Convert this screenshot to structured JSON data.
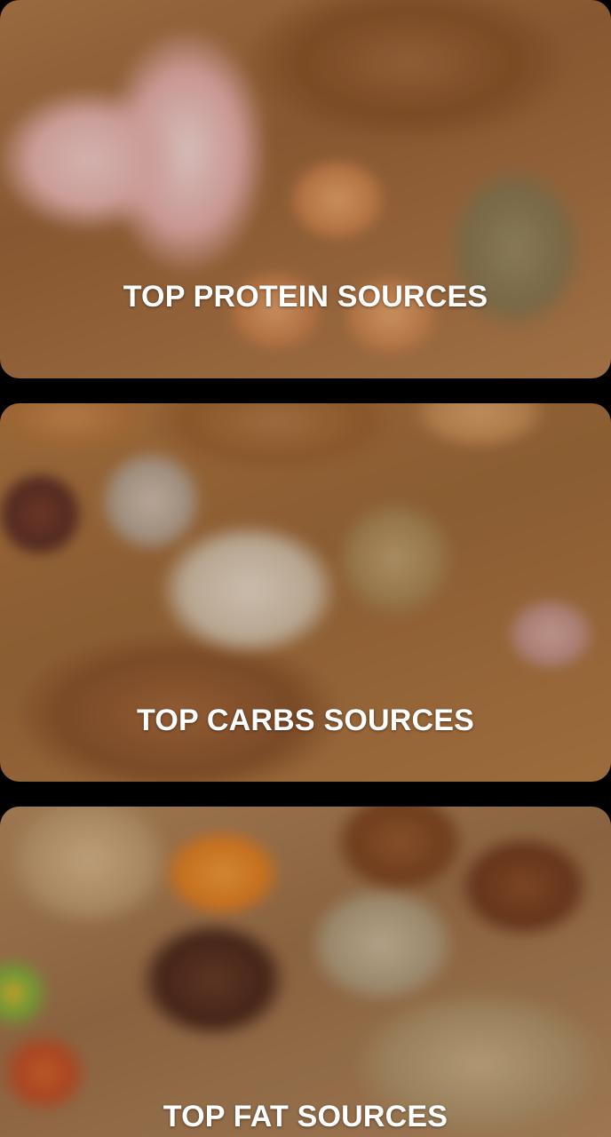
{
  "cards": [
    {
      "title": "TOP PROTEIN SOURCES",
      "image": "protein-foods-photo"
    },
    {
      "title": "TOP CARBS SOURCES",
      "image": "carbs-foods-photo"
    },
    {
      "title": "TOP FAT SOURCES",
      "image": "fat-foods-photo"
    }
  ]
}
